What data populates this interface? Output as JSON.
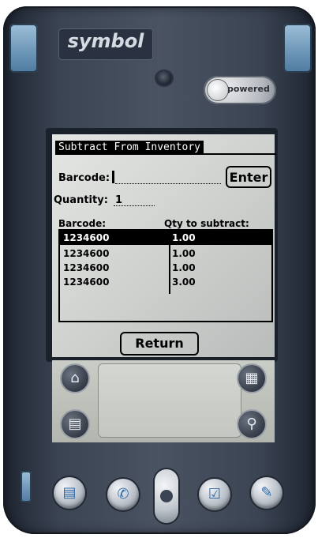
{
  "device": {
    "brand": "symbol",
    "badge": "powered"
  },
  "screen": {
    "title": "Subtract From Inventory",
    "barcode_label": "Barcode:",
    "enter_label": "Enter",
    "quantity_label": "Quantity:",
    "quantity_value": "1",
    "columns": [
      "Barcode:",
      "Qty to subtract:"
    ],
    "rows": [
      {
        "barcode": "1234600",
        "qty": "1.00",
        "selected": true
      },
      {
        "barcode": "1234600",
        "qty": "1.00",
        "selected": false
      },
      {
        "barcode": "1234600",
        "qty": "1.00",
        "selected": false
      },
      {
        "barcode": "1234600",
        "qty": "3.00",
        "selected": false
      }
    ],
    "return_label": "Return"
  },
  "graffiti": {
    "icons": [
      "home-icon",
      "applications-icon",
      "menu-icon",
      "find-icon"
    ],
    "icon_glyphs": {
      "home": "⌂",
      "apps": "▦",
      "menu": "▤",
      "find": "⚲"
    }
  },
  "hardware_buttons": [
    "date-book-icon",
    "phone-icon",
    "scroll-rocker",
    "to-do-icon",
    "memo-icon"
  ],
  "hardware_glyphs": {
    "datebook": "▤",
    "phone": "✆",
    "todo": "☑",
    "memo": "✎"
  }
}
